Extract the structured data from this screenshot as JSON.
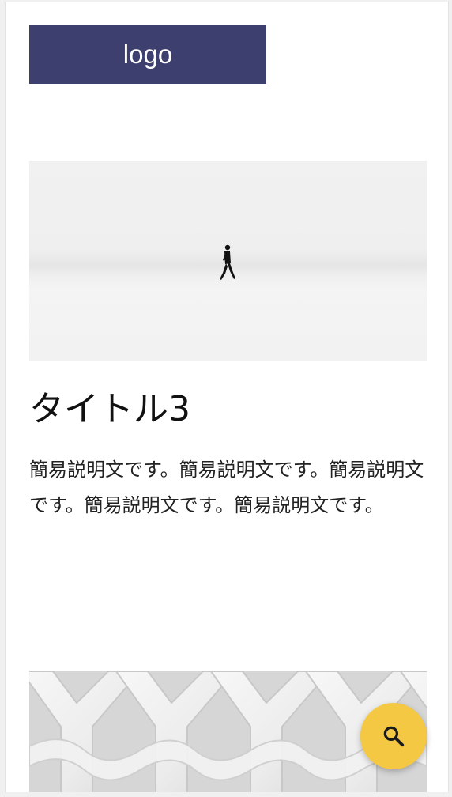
{
  "header": {
    "logo_text": "logo"
  },
  "card": {
    "image_alt": "person-walking-in-snow",
    "title": "タイトル3",
    "description": "簡易説明文です。簡易説明文です。簡易説明文です。簡易説明文です。簡易説明文です。"
  },
  "next_card": {
    "image_alt": "white-lattice-pattern"
  },
  "fab": {
    "icon": "search-icon",
    "color": "#f4c842"
  },
  "colors": {
    "logo_bg": "#3d3f6e",
    "logo_text": "#ffffff",
    "accent": "#f4c842"
  }
}
